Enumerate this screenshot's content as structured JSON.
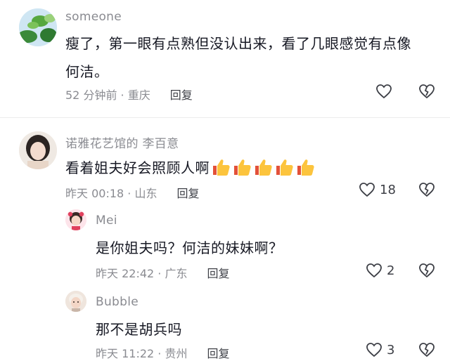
{
  "comments": [
    {
      "author": "someone",
      "text_line1": "瘦了，第一眼有点熟但没认出来，看了几眼感觉有点像",
      "text_line2": "何洁。",
      "time": "52 分钟前 · 重庆",
      "reply_label": "回复",
      "like_count": "",
      "avatar_icon": "leaves-avatar"
    },
    {
      "author": "诺雅花艺馆的 李百意",
      "text": "看着姐夫好会照顾人啊",
      "emoji": [
        "thumbs-up",
        "thumbs-up",
        "thumbs-up",
        "thumbs-up",
        "thumbs-up"
      ],
      "time": "昨天 00:18 · 山东",
      "reply_label": "回复",
      "like_count": "18",
      "avatar_icon": "girl-portrait-avatar"
    }
  ],
  "replies": [
    {
      "author": "Mei",
      "text": "是你姐夫吗？何洁的妹妹啊？",
      "time": "昨天 22:42 · 广东",
      "reply_label": "回复",
      "like_count": "2",
      "avatar_icon": "child-avatar"
    },
    {
      "author": "Bubble",
      "text": "那不是胡兵吗",
      "time": "昨天 11:22 · 贵州",
      "reply_label": "回复",
      "like_count": "3",
      "avatar_icon": "baby-avatar"
    }
  ],
  "colors": {
    "text": "#161823",
    "secondary": "#8a8b91",
    "divider": "#ececec"
  }
}
